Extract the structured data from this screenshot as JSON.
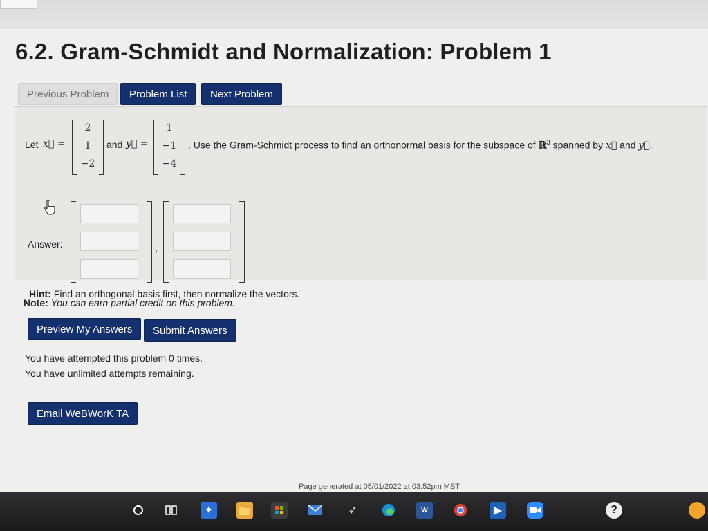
{
  "page": {
    "title": "6.2. Gram-Schmidt and Normalization: Problem 1"
  },
  "nav": {
    "previous": "Previous Problem",
    "list": "Problem List",
    "next": "Next Problem"
  },
  "problem": {
    "let_label": "Let",
    "x_symbol": "x⃗ =",
    "x_vector": [
      "2",
      "1",
      "−2"
    ],
    "and_label": "and",
    "y_symbol": "y⃗ =",
    "y_vector": [
      "1",
      "−1",
      "−4"
    ],
    "statement_before": ". Use the Gram-Schmidt process to find an orthonormal basis for the subspace of",
    "space_symbol": "ℝ",
    "space_exponent": "3",
    "statement_after": "spanned by",
    "x_ref": "x⃗",
    "and_between": "and",
    "y_ref": "y⃗",
    "period": "."
  },
  "answer": {
    "label": "Answer:",
    "separator": ",",
    "vector1": [
      "",
      "",
      ""
    ],
    "vector2": [
      "",
      "",
      ""
    ]
  },
  "hint": {
    "label": "Hint:",
    "text": "Find an orthogonal basis first, then normalize the vectors."
  },
  "note": {
    "label": "Note:",
    "text": "You can earn partial credit on this problem."
  },
  "actions": {
    "preview": "Preview My Answers",
    "submit": "Submit Answers"
  },
  "attempts": {
    "line1": "You have attempted this problem 0 times.",
    "line2": "You have unlimited attempts remaining."
  },
  "email_button": "Email WeBWorK TA",
  "footer": "Page generated at 05/01/2022 at 03:52pm MST",
  "taskbar": {
    "icons": [
      "start-search-circle-icon",
      "task-view-icon",
      "dropbox-icon",
      "file-explorer-icon",
      "store-icon",
      "mail-icon",
      "feather-app-icon",
      "edge-browser-icon",
      "word-icon",
      "chrome-icon",
      "media-player-icon",
      "zoom-icon",
      "help-icon"
    ]
  },
  "colors": {
    "primary_button": "#14316e",
    "page_background": "#efefed",
    "taskbar": "#1f1f21"
  }
}
